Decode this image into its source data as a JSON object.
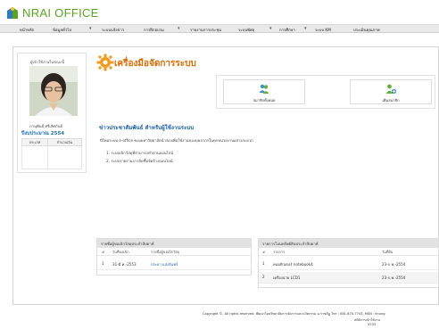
{
  "header": {
    "brand": "NRAI OFFICE"
  },
  "nav": {
    "items": [
      {
        "label": "หน้าหลัก",
        "caret": false
      },
      {
        "label": "ข้อมูลทั่วไป",
        "caret": true
      },
      {
        "label": "ระบบแจ้งข่าว",
        "caret": false
      },
      {
        "label": "การฝึกอบรม",
        "caret": true
      },
      {
        "label": "รายงานการประชุม",
        "caret": false
      },
      {
        "label": "ระบบพัสดุ",
        "caret": true
      },
      {
        "label": "การศึกษา",
        "caret": true
      },
      {
        "label": "ระบบ KM",
        "caret": false
      },
      {
        "label": "ประเมินคุณภาพ",
        "caret": false
      }
    ]
  },
  "profile": {
    "caption": "ผู้เข้าใช้งานในขณะนี้",
    "name": "ภานุพันธ์ ศรีเลิศกันย์",
    "fiscal_year": "ปีงบประมาณ 2554",
    "table_headers": [
      "ประเภท",
      "จำนวนเงิน"
    ]
  },
  "page": {
    "title": "เครื่องมือจัดการระบบ"
  },
  "quick_actions": [
    {
      "label": "สมาชิกทั้งหมด",
      "icon": "users-icon"
    },
    {
      "label": "เพิ่มสมาชิก",
      "icon": "add-user-icon"
    }
  ],
  "news": {
    "heading": "ข่าวประชาสัมพันธ์ สำหรับผู้ใช้งานระบบ",
    "body": "ปีใหม่ระบบ e-office ของมหาวิทยาลัยนำร่องเพื่อใช้งานของบุคลากรในทุกหน่วยงานอย่างสะดวก",
    "items": [
      "1.  ระบบเบิกวัสดุที่สามารถทำผ่านออนไลน์",
      "2.  ระบบรายงานการจัดซื้อจัดจ้างออนไลน์"
    ]
  },
  "requests_table": {
    "title": "รายชื่อผู้ขอเบิกวัสดุประจำสัปดาห์",
    "columns": [
      "#",
      "วันที่ขอเบิก",
      "รายชื่อผู้ขอเบิกวัสดุ"
    ],
    "rows": [
      {
        "num": "1",
        "date": "31-มี.ค.-2553",
        "name": "ประยา แสงจันทร์"
      }
    ]
  },
  "repairs_table": {
    "title": "รายการโอนทรัพย์สินประจำสัปดาห์",
    "columns": [
      "#",
      "รายการ",
      "วันที่ยืม"
    ],
    "rows": [
      {
        "num": "1",
        "item": "คอมพิวเตอร์ notebook4",
        "date": "23-ก.พ.-2554"
      },
      {
        "num": "2",
        "item": "เครื่องฉาย LCD1",
        "date": "23-ก.พ.-2554"
      }
    ]
  },
  "footer": {
    "line1": "Copyright ©. All rights reserved. พัฒนาโดยวิทยาลัยการจัดการและนวัตกรรม ม.ราชภัฏ โทร : 081-670-7743, MSN : khung",
    "line2": "สถิติการเข้าใช้งาน",
    "line3": "4703"
  },
  "colors": {
    "brand": "#5aa51f",
    "title": "#e06a00",
    "link": "#1a5fb0"
  }
}
